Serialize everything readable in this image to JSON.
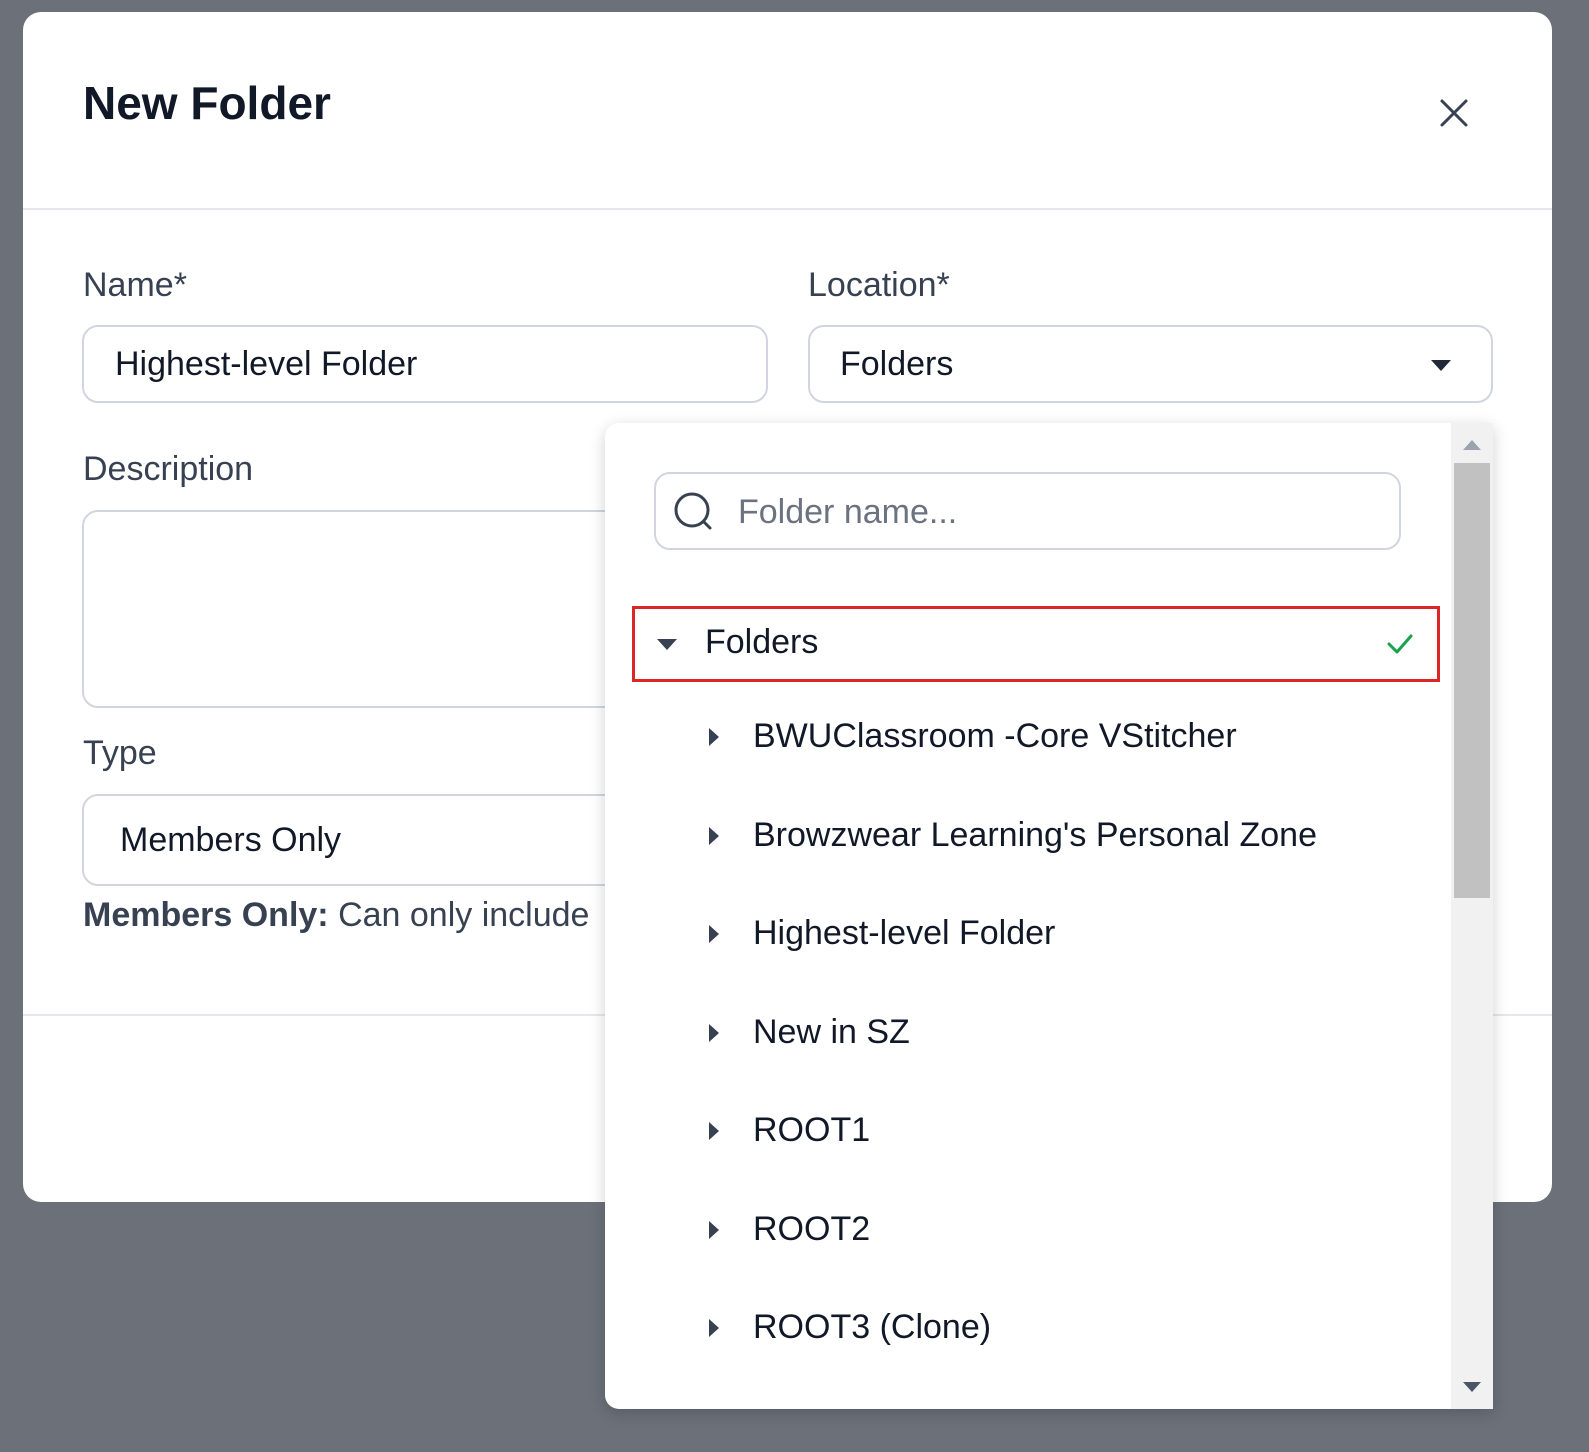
{
  "modal": {
    "title": "New Folder",
    "close_icon": "close-icon"
  },
  "form": {
    "name": {
      "label": "Name*",
      "value": "Highest-level Folder"
    },
    "location": {
      "label": "Location*",
      "value": "Folders"
    },
    "description": {
      "label": "Description",
      "value": ""
    },
    "type": {
      "label": "Type",
      "value": "Members Only",
      "help_bold": "Members Only:",
      "help_text": " Can only include"
    }
  },
  "dropdown": {
    "search_placeholder": "Folder name...",
    "root": {
      "label": "Folders",
      "selected": true
    },
    "children": [
      {
        "label": "BWUClassroom -Core VStitcher"
      },
      {
        "label": "Browzwear Learning's Personal Zone"
      },
      {
        "label": "Highest-level Folder"
      },
      {
        "label": "New in SZ"
      },
      {
        "label": "ROOT1"
      },
      {
        "label": "ROOT2"
      },
      {
        "label": "ROOT3 (Clone)"
      }
    ]
  },
  "colors": {
    "overlay": "#6b7079",
    "highlight_border": "#dc2626",
    "check": "#16a34a"
  }
}
